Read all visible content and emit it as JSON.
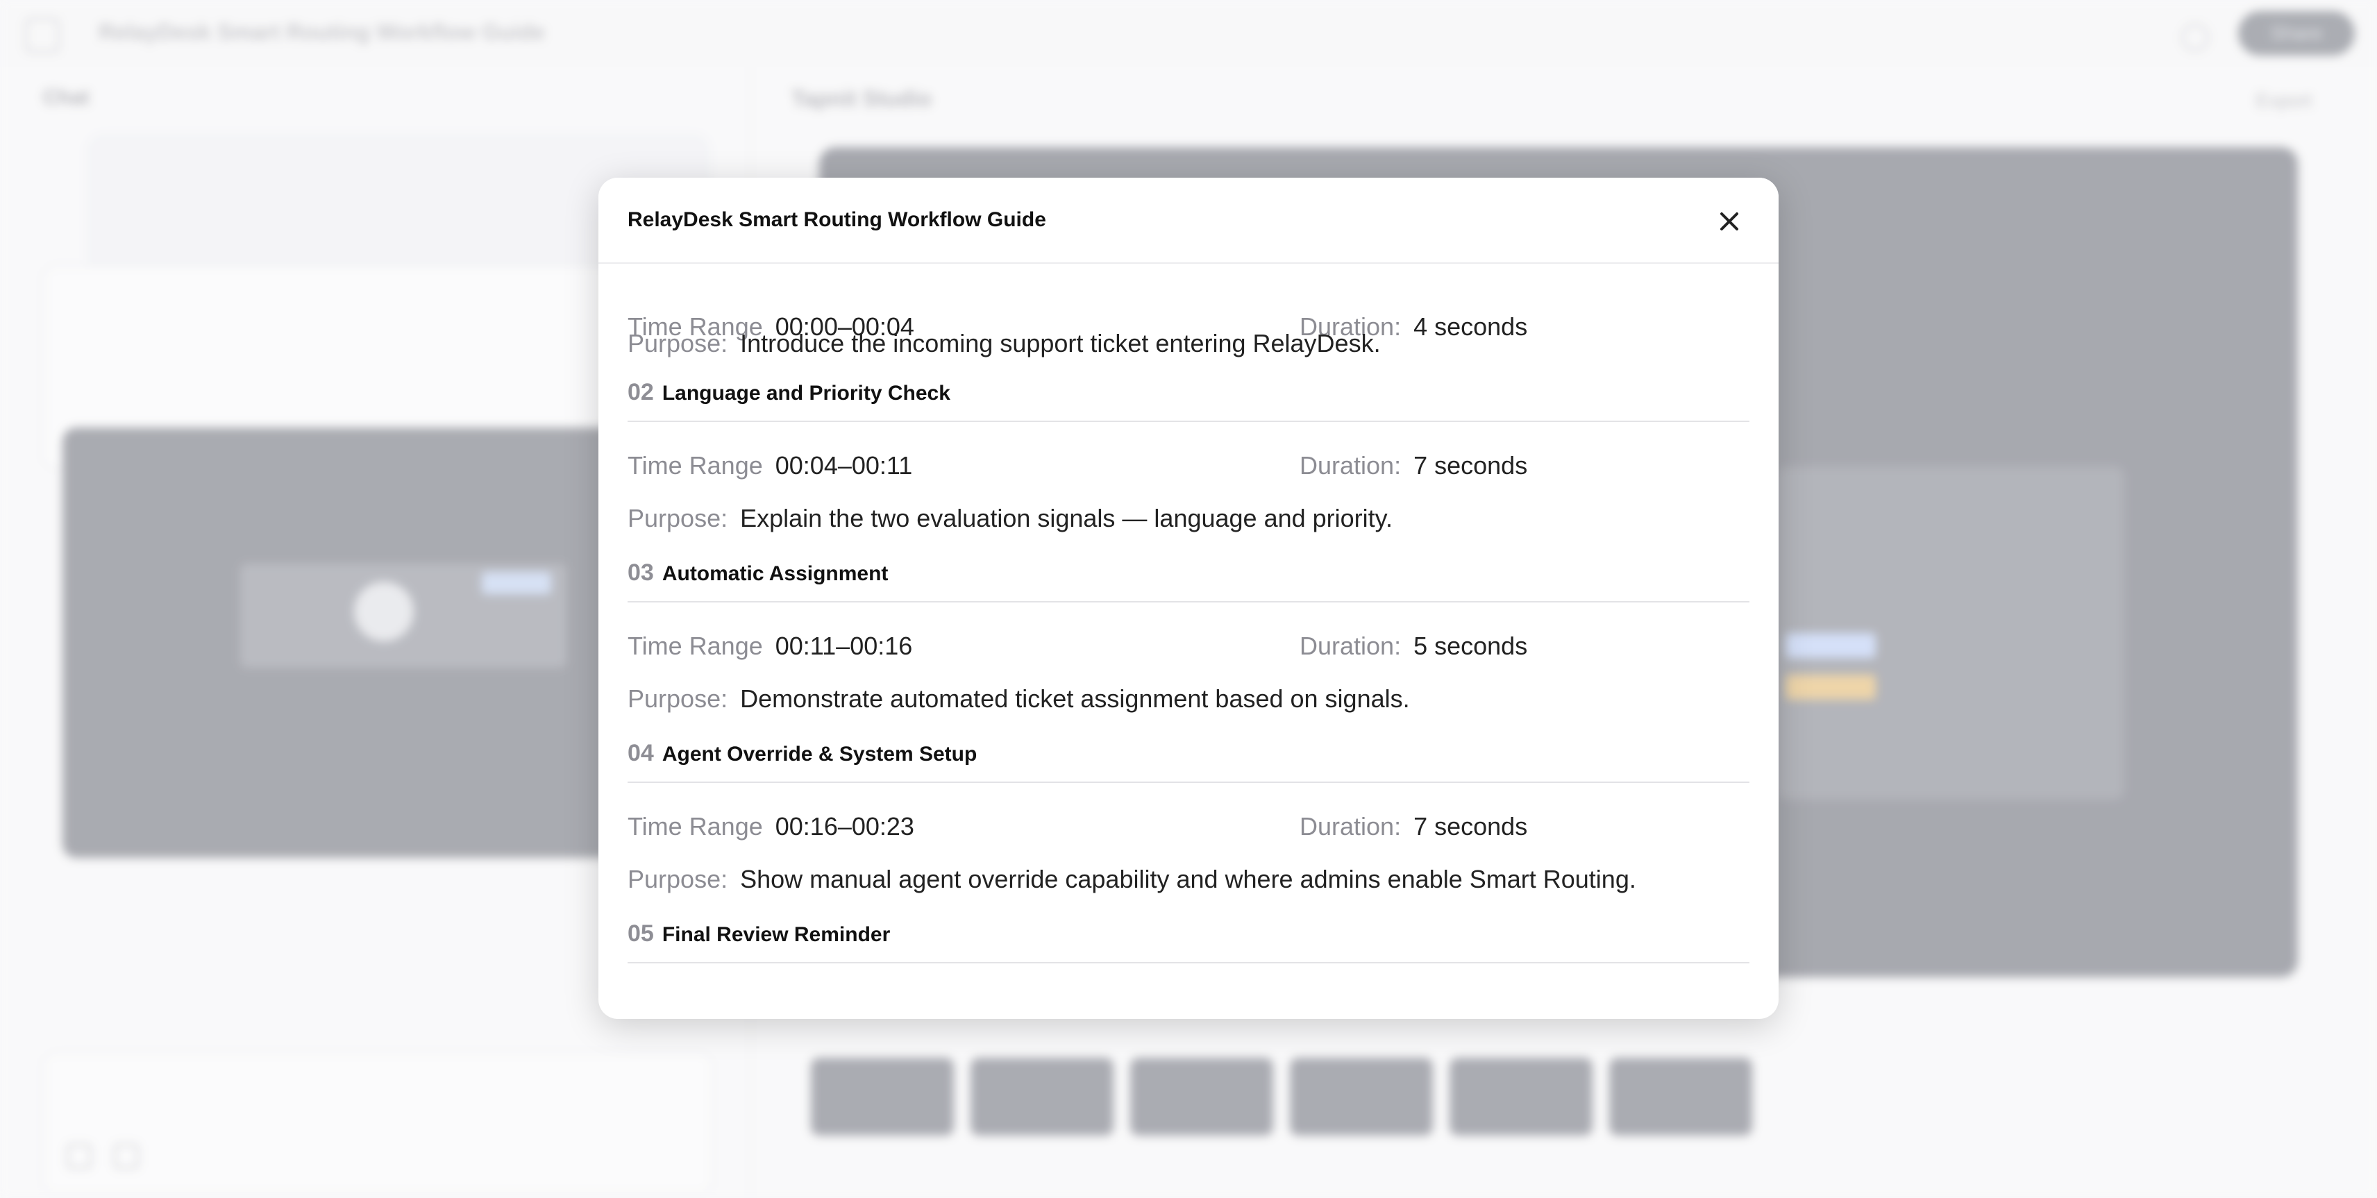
{
  "app": {
    "title": "RelayDesk Smart Routing Workflow Guide",
    "share_label": "Share",
    "chat_label": "Chat",
    "studio_label": "Tapnit Studio",
    "export_label": "Export"
  },
  "modal": {
    "title": "RelayDesk Smart Routing Workflow Guide",
    "close_icon": "close-icon",
    "first": {
      "time_label": "Time Range",
      "time_value": "00:00–00:04",
      "duration_label": "Duration:",
      "duration_value": "4 seconds",
      "purpose_label": "Purpose:",
      "purpose_value": "Introduce the incoming support ticket entering RelayDesk."
    },
    "sections": [
      {
        "num": "02",
        "title": "Language and Priority Check",
        "time_label": "Time Range",
        "time_value": "00:04–00:11",
        "duration_label": "Duration:",
        "duration_value": "7 seconds",
        "purpose_label": "Purpose:",
        "purpose_value": "Explain the two evaluation signals — language and priority."
      },
      {
        "num": "03",
        "title": "Automatic Assignment",
        "time_label": "Time Range",
        "time_value": "00:11–00:16",
        "duration_label": "Duration:",
        "duration_value": "5 seconds",
        "purpose_label": "Purpose:",
        "purpose_value": "Demonstrate automated ticket assignment based on signals."
      },
      {
        "num": "04",
        "title": "Agent Override & System Setup",
        "time_label": "Time Range",
        "time_value": "00:16–00:23",
        "duration_label": "Duration:",
        "duration_value": "7 seconds",
        "purpose_label": "Purpose:",
        "purpose_value": "Show manual agent override capability and where admins enable Smart Routing."
      },
      {
        "num": "05",
        "title": "Final Review Reminder"
      }
    ]
  }
}
